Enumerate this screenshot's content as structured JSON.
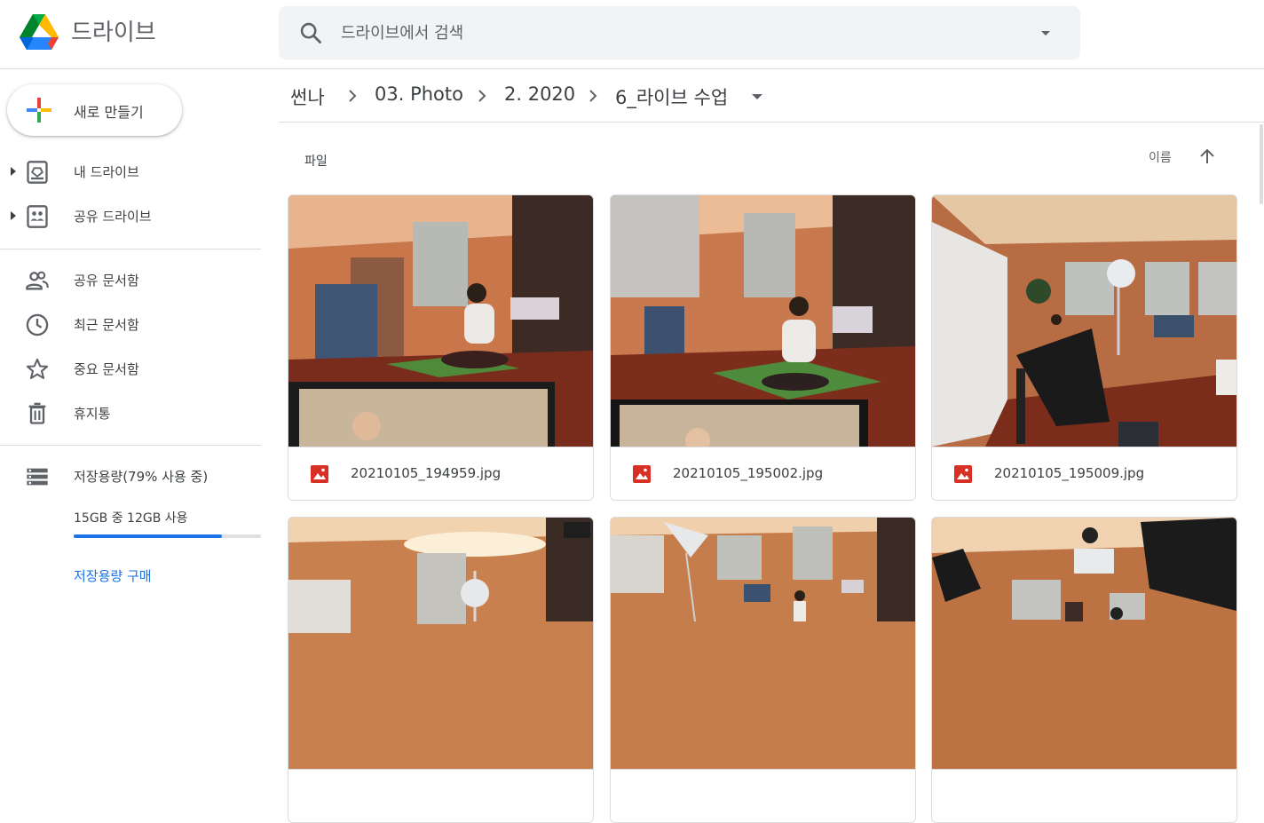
{
  "app": {
    "name": "드라이브"
  },
  "search": {
    "placeholder": "드라이브에서 검색"
  },
  "sidebar": {
    "new_button": "새로 만들기",
    "items": [
      {
        "label": "내 드라이브",
        "icon": "my-drive-icon"
      },
      {
        "label": "공유 드라이브",
        "icon": "shared-drives-icon"
      },
      {
        "label": "공유 문서함",
        "icon": "people-icon"
      },
      {
        "label": "최근 문서함",
        "icon": "clock-icon"
      },
      {
        "label": "중요 문서함",
        "icon": "star-icon"
      },
      {
        "label": "휴지통",
        "icon": "trash-icon"
      },
      {
        "label": "저장용량(79% 사용 중)",
        "icon": "storage-icon"
      }
    ],
    "storage": {
      "usage_text": "15GB 중 12GB 사용",
      "used_fraction": 0.79,
      "buy_label": "저장용량 구매"
    }
  },
  "breadcrumb": [
    "썬나",
    "03. Photo",
    "2. 2020",
    "6_라이브 수업"
  ],
  "files": {
    "section_label": "파일",
    "sort_label": "이름",
    "items": [
      {
        "name": "20210105_194959.jpg"
      },
      {
        "name": "20210105_195002.jpg"
      },
      {
        "name": "20210105_195009.jpg"
      },
      {
        "name": ""
      },
      {
        "name": ""
      },
      {
        "name": ""
      }
    ]
  },
  "colors": {
    "accent": "#1a73e8",
    "image_icon": "#d93025",
    "divider": "#dadce0"
  }
}
